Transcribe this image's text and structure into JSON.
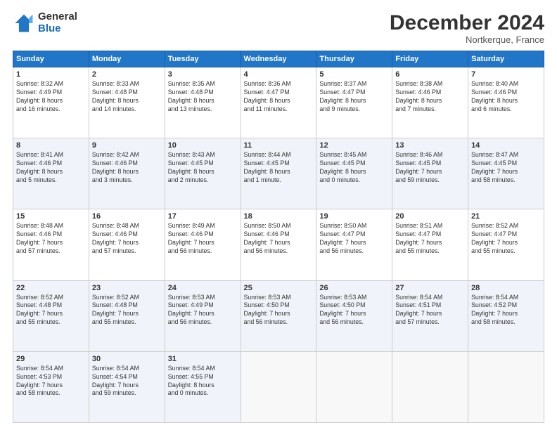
{
  "header": {
    "logo_general": "General",
    "logo_blue": "Blue",
    "month_title": "December 2024",
    "subtitle": "Nortkerque, France"
  },
  "weekdays": [
    "Sunday",
    "Monday",
    "Tuesday",
    "Wednesday",
    "Thursday",
    "Friday",
    "Saturday"
  ],
  "weeks": [
    [
      {
        "day": "1",
        "info": "Sunrise: 8:32 AM\nSunset: 4:49 PM\nDaylight: 8 hours\nand 16 minutes."
      },
      {
        "day": "2",
        "info": "Sunrise: 8:33 AM\nSunset: 4:48 PM\nDaylight: 8 hours\nand 14 minutes."
      },
      {
        "day": "3",
        "info": "Sunrise: 8:35 AM\nSunset: 4:48 PM\nDaylight: 8 hours\nand 13 minutes."
      },
      {
        "day": "4",
        "info": "Sunrise: 8:36 AM\nSunset: 4:47 PM\nDaylight: 8 hours\nand 11 minutes."
      },
      {
        "day": "5",
        "info": "Sunrise: 8:37 AM\nSunset: 4:47 PM\nDaylight: 8 hours\nand 9 minutes."
      },
      {
        "day": "6",
        "info": "Sunrise: 8:38 AM\nSunset: 4:46 PM\nDaylight: 8 hours\nand 7 minutes."
      },
      {
        "day": "7",
        "info": "Sunrise: 8:40 AM\nSunset: 4:46 PM\nDaylight: 8 hours\nand 6 minutes."
      }
    ],
    [
      {
        "day": "8",
        "info": "Sunrise: 8:41 AM\nSunset: 4:46 PM\nDaylight: 8 hours\nand 5 minutes."
      },
      {
        "day": "9",
        "info": "Sunrise: 8:42 AM\nSunset: 4:46 PM\nDaylight: 8 hours\nand 3 minutes."
      },
      {
        "day": "10",
        "info": "Sunrise: 8:43 AM\nSunset: 4:45 PM\nDaylight: 8 hours\nand 2 minutes."
      },
      {
        "day": "11",
        "info": "Sunrise: 8:44 AM\nSunset: 4:45 PM\nDaylight: 8 hours\nand 1 minute."
      },
      {
        "day": "12",
        "info": "Sunrise: 8:45 AM\nSunset: 4:45 PM\nDaylight: 8 hours\nand 0 minutes."
      },
      {
        "day": "13",
        "info": "Sunrise: 8:46 AM\nSunset: 4:45 PM\nDaylight: 7 hours\nand 59 minutes."
      },
      {
        "day": "14",
        "info": "Sunrise: 8:47 AM\nSunset: 4:45 PM\nDaylight: 7 hours\nand 58 minutes."
      }
    ],
    [
      {
        "day": "15",
        "info": "Sunrise: 8:48 AM\nSunset: 4:46 PM\nDaylight: 7 hours\nand 57 minutes."
      },
      {
        "day": "16",
        "info": "Sunrise: 8:48 AM\nSunset: 4:46 PM\nDaylight: 7 hours\nand 57 minutes."
      },
      {
        "day": "17",
        "info": "Sunrise: 8:49 AM\nSunset: 4:46 PM\nDaylight: 7 hours\nand 56 minutes."
      },
      {
        "day": "18",
        "info": "Sunrise: 8:50 AM\nSunset: 4:46 PM\nDaylight: 7 hours\nand 56 minutes."
      },
      {
        "day": "19",
        "info": "Sunrise: 8:50 AM\nSunset: 4:47 PM\nDaylight: 7 hours\nand 56 minutes."
      },
      {
        "day": "20",
        "info": "Sunrise: 8:51 AM\nSunset: 4:47 PM\nDaylight: 7 hours\nand 55 minutes."
      },
      {
        "day": "21",
        "info": "Sunrise: 8:52 AM\nSunset: 4:47 PM\nDaylight: 7 hours\nand 55 minutes."
      }
    ],
    [
      {
        "day": "22",
        "info": "Sunrise: 8:52 AM\nSunset: 4:48 PM\nDaylight: 7 hours\nand 55 minutes."
      },
      {
        "day": "23",
        "info": "Sunrise: 8:52 AM\nSunset: 4:48 PM\nDaylight: 7 hours\nand 55 minutes."
      },
      {
        "day": "24",
        "info": "Sunrise: 8:53 AM\nSunset: 4:49 PM\nDaylight: 7 hours\nand 56 minutes."
      },
      {
        "day": "25",
        "info": "Sunrise: 8:53 AM\nSunset: 4:50 PM\nDaylight: 7 hours\nand 56 minutes."
      },
      {
        "day": "26",
        "info": "Sunrise: 8:53 AM\nSunset: 4:50 PM\nDaylight: 7 hours\nand 56 minutes."
      },
      {
        "day": "27",
        "info": "Sunrise: 8:54 AM\nSunset: 4:51 PM\nDaylight: 7 hours\nand 57 minutes."
      },
      {
        "day": "28",
        "info": "Sunrise: 8:54 AM\nSunset: 4:52 PM\nDaylight: 7 hours\nand 58 minutes."
      }
    ],
    [
      {
        "day": "29",
        "info": "Sunrise: 8:54 AM\nSunset: 4:53 PM\nDaylight: 7 hours\nand 58 minutes."
      },
      {
        "day": "30",
        "info": "Sunrise: 8:54 AM\nSunset: 4:54 PM\nDaylight: 7 hours\nand 59 minutes."
      },
      {
        "day": "31",
        "info": "Sunrise: 8:54 AM\nSunset: 4:55 PM\nDaylight: 8 hours\nand 0 minutes."
      },
      {
        "day": "",
        "info": ""
      },
      {
        "day": "",
        "info": ""
      },
      {
        "day": "",
        "info": ""
      },
      {
        "day": "",
        "info": ""
      }
    ]
  ]
}
